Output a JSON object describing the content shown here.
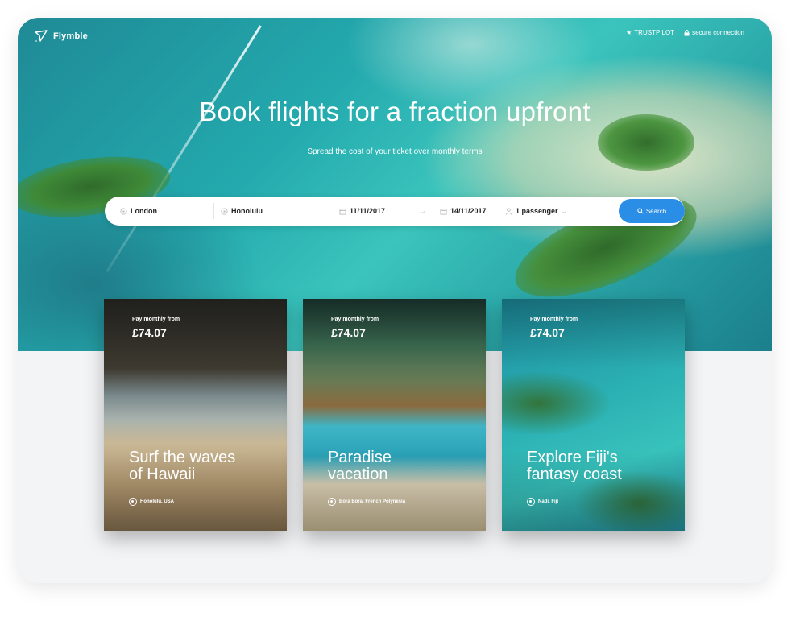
{
  "brand": {
    "name": "Flymble",
    "logo_icon": "paper-plane-icon"
  },
  "header": {
    "trustpilot": "TRUSTPILOT",
    "secure": "secure connection"
  },
  "hero": {
    "title": "Book flights for a fraction upfront",
    "subtitle": "Spread the cost of your ticket over monthly terms"
  },
  "search": {
    "from": "London",
    "to": "Honolulu",
    "depart": "11/11/2017",
    "return": "14/11/2017",
    "passengers": "1 passenger",
    "button": "Search"
  },
  "cards": [
    {
      "pay_label": "Pay monthly from",
      "price": "£74.07",
      "title_line1": "Surf the waves",
      "title_line2": "of Hawaii",
      "location": "Honolulu, USA"
    },
    {
      "pay_label": "Pay monthly from",
      "price": "£74.07",
      "title_line1": "Paradise",
      "title_line2": "vacation",
      "location": "Bora Bora, French Polynesia"
    },
    {
      "pay_label": "Pay monthly from",
      "price": "£74.07",
      "title_line1": "Explore Fiji's",
      "title_line2": "fantasy coast",
      "location": "Nadi, Fiji"
    }
  ],
  "colors": {
    "accent": "#2a8ee6",
    "background": "#f3f4f6"
  }
}
